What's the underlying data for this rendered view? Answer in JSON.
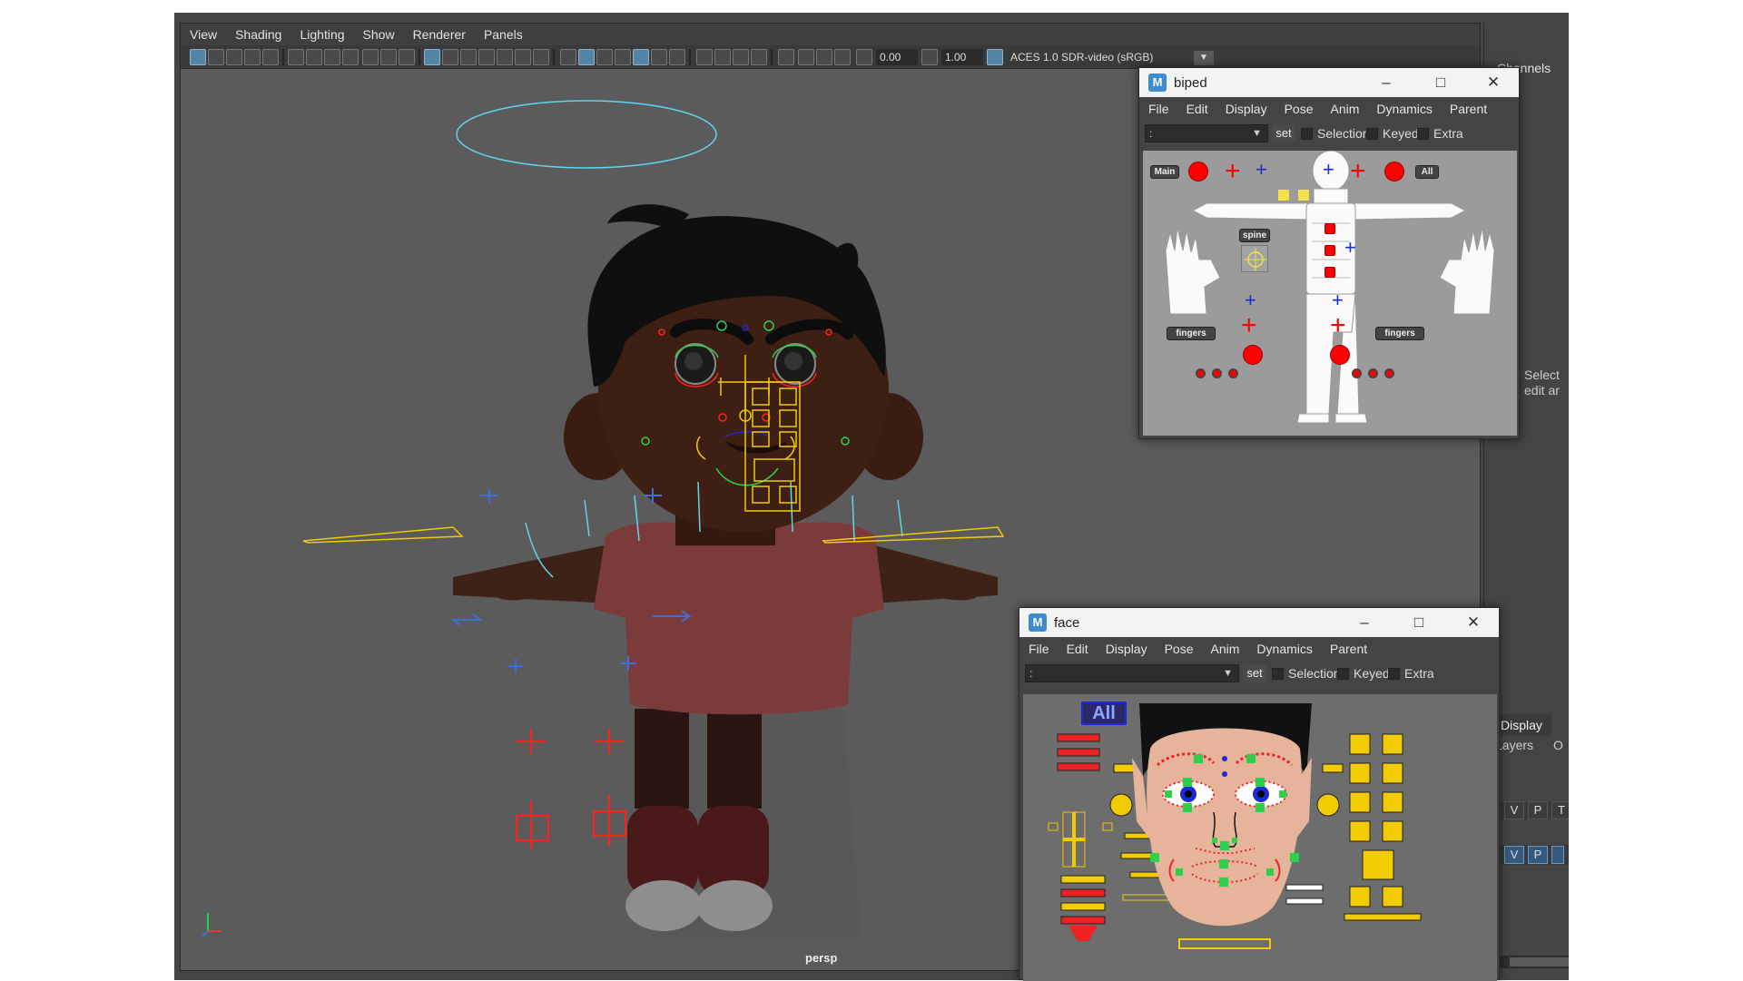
{
  "viewport": {
    "menu": [
      "View",
      "Shading",
      "Lighting",
      "Show",
      "Renderer",
      "Panels"
    ],
    "exposure": "0.00",
    "gamma": "1.00",
    "color_space": "ACES 1.0 SDR-video (sRGB)",
    "camera_label": "persp"
  },
  "right_panel": {
    "channels_tab": "Channels",
    "select_hint": "Select\nedit ar",
    "display_tab": "Display",
    "layers_tab": "Layers",
    "layers_o": "O",
    "vpt": [
      "V",
      "P",
      "T"
    ]
  },
  "biped_window": {
    "title": "biped",
    "menu": [
      "File",
      "Edit",
      "Display",
      "Pose",
      "Anim",
      "Dynamics",
      "Parent"
    ],
    "namespace_value": ":",
    "set_label": "set",
    "check_selection": "Selection",
    "check_keyed": "Keyed",
    "check_extra": "Extra",
    "btn_main": "Main",
    "btn_all": "All",
    "label_spine": "spine",
    "label_fingers_left": "fingers",
    "label_fingers_right": "fingers"
  },
  "face_window": {
    "title": "face",
    "menu": [
      "File",
      "Edit",
      "Display",
      "Pose",
      "Anim",
      "Dynamics",
      "Parent"
    ],
    "namespace_value": ":",
    "set_label": "set",
    "check_selection": "Selection",
    "check_keyed": "Keyed",
    "check_extra": "Extra",
    "btn_all": "All"
  },
  "colors": {
    "controller_red": "#ff0000",
    "controller_yellow": "#f2cc00",
    "controller_blue": "#1b2ad8",
    "controller_green": "#2bd14a",
    "curve_cyan": "#5fd4f0",
    "maya_blue": "#5285a6"
  }
}
